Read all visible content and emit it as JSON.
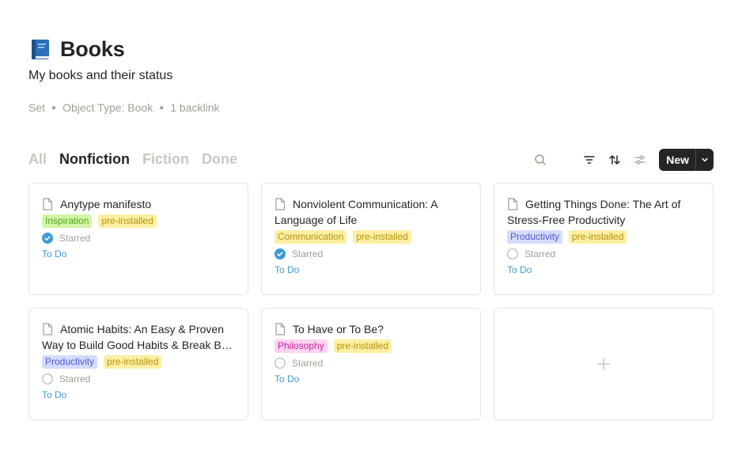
{
  "page": {
    "title": "Books",
    "title_icon": "blue-book-icon",
    "description": "My books and their status",
    "meta": [
      "Set",
      "Object Type: Book",
      "1 backlink"
    ]
  },
  "tabs": [
    "All",
    "Nonfiction",
    "Fiction",
    "Done"
  ],
  "active_tab": "Nonfiction",
  "toolbar": {
    "new_label": "New"
  },
  "colors": {
    "accent_blue": "#3e9ad6",
    "check_blue": "#3e9ad6",
    "tag_yellow_bg": "#fcefa3",
    "tag_yellow_fg": "#b8920c",
    "tag_green_bg": "#d3f5a8",
    "tag_green_fg": "#53a51b",
    "tag_purple_bg": "#d5dbff",
    "tag_purple_fg": "#4d5ecf",
    "tag_pink_bg": "#ffd3f0",
    "tag_pink_fg": "#c4259c"
  },
  "cards": [
    {
      "title": "Anytype manifesto",
      "tags": [
        {
          "label": "Inspiration",
          "bg": "#d3f5a8",
          "fg": "#53a51b"
        },
        {
          "label": "pre-installed",
          "bg": "#fcefa3",
          "fg": "#b8920c"
        }
      ],
      "starred": true,
      "starred_label": "Starred",
      "status": "To Do"
    },
    {
      "title": "Nonviolent Communication: A Language of Life",
      "tags": [
        {
          "label": "Communication",
          "bg": "#fcefa3",
          "fg": "#b8920c"
        },
        {
          "label": "pre-installed",
          "bg": "#fcefa3",
          "fg": "#b8920c"
        }
      ],
      "starred": true,
      "starred_label": "Starred",
      "status": "To Do"
    },
    {
      "title": "Getting Things Done: The Art of Stress-Free Productivity",
      "tags": [
        {
          "label": "Productivity",
          "bg": "#d5dbff",
          "fg": "#4d5ecf"
        },
        {
          "label": "pre-installed",
          "bg": "#fcefa3",
          "fg": "#b8920c"
        }
      ],
      "starred": false,
      "starred_label": "Starred",
      "status": "To Do"
    },
    {
      "title": "Atomic Habits: An Easy & Proven Way to Build Good Habits & Break Bad Ones",
      "tags": [
        {
          "label": "Productivity",
          "bg": "#d5dbff",
          "fg": "#4d5ecf"
        },
        {
          "label": "pre-installed",
          "bg": "#fcefa3",
          "fg": "#b8920c"
        }
      ],
      "starred": false,
      "starred_label": "Starred",
      "status": "To Do"
    },
    {
      "title": "To Have or To Be?",
      "tags": [
        {
          "label": "Philosophy",
          "bg": "#ffd3f0",
          "fg": "#c4259c"
        },
        {
          "label": "pre-installed",
          "bg": "#fcefa3",
          "fg": "#b8920c"
        }
      ],
      "starred": false,
      "starred_label": "Starred",
      "status": "To Do"
    }
  ]
}
